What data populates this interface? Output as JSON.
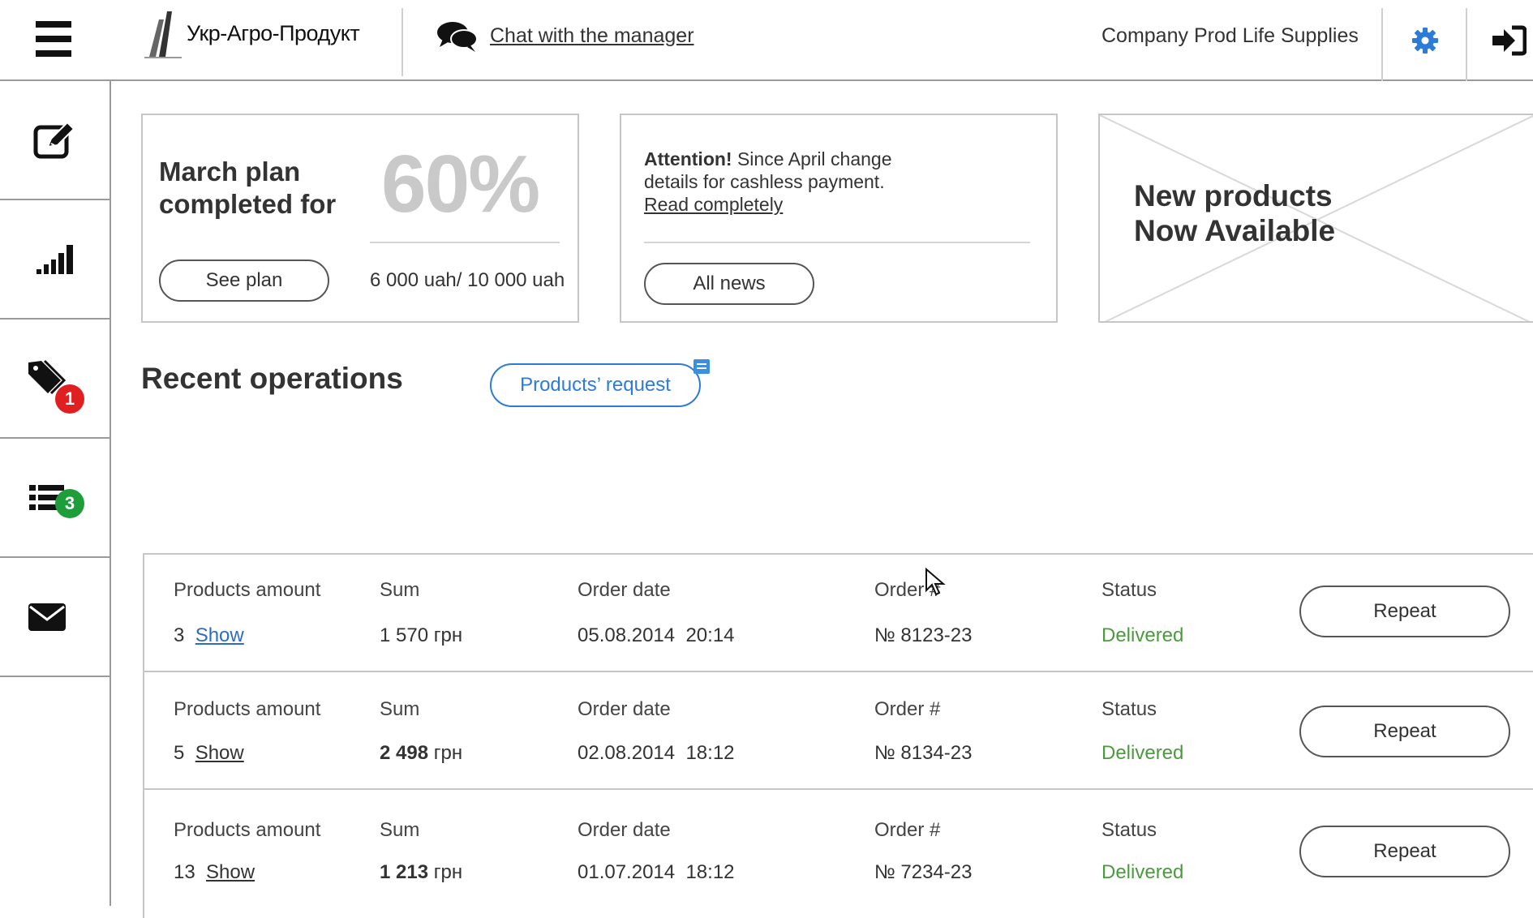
{
  "header": {
    "logo_text": "Укр-Агро-Продукт",
    "chat_link": "Chat with the manager",
    "company_name": "Company Prod Life Supplies",
    "icons": [
      "menu-icon",
      "logo-icon",
      "chat-icon",
      "gear-icon",
      "logout-icon"
    ]
  },
  "sidebar": {
    "items": [
      {
        "icon": "edit-icon"
      },
      {
        "icon": "signal-icon"
      },
      {
        "icon": "tags-icon",
        "badge": "1",
        "badge_color": "#e02020"
      },
      {
        "icon": "list-icon",
        "badge": "3",
        "badge_color": "#1e9e3a"
      },
      {
        "icon": "envelope-icon"
      }
    ]
  },
  "plan_card": {
    "title": "March plan completed for",
    "percent": "60%",
    "button": "See plan",
    "amount": "6 000 uah/ 10 000 uah"
  },
  "news_card": {
    "attention": "Attention!",
    "text_1": " Since April change",
    "text_2": "details for cashless payment.",
    "read_link": "Read completely",
    "button": "All news"
  },
  "promo_card": {
    "line1": "New products",
    "line2": "Now Available"
  },
  "recent": {
    "title": "Recent operations",
    "request_button": "Products’ request"
  },
  "table": {
    "labels": {
      "amount": "Products amount",
      "sum": "Sum",
      "date": "Order date",
      "order": "Order #",
      "status": "Status"
    },
    "rows": [
      {
        "count": "3",
        "show": "Show",
        "sum_num": "1 570",
        "sum_cur": "грн",
        "date": "05.08.2014  20:14",
        "order": "№ 8123-23",
        "status": "Delivered",
        "repeat": "Repeat"
      },
      {
        "count": "5",
        "show": "Show",
        "sum_num": "2 498",
        "sum_cur": "грн",
        "date": "02.08.2014  18:12",
        "order": "№ 8134-23",
        "status": "Delivered",
        "repeat": "Repeat"
      },
      {
        "count": "13",
        "show": "Show",
        "sum_num": "1 213",
        "sum_cur": "грн",
        "date": "01.07.2014  18:12",
        "order": "№ 7234-23",
        "status": "Delivered",
        "repeat": "Repeat"
      }
    ]
  },
  "colors": {
    "accent_blue": "#2c7bd6",
    "delivered_green": "#4a9b3e",
    "badge_red": "#e02020",
    "badge_green": "#1e9e3a"
  }
}
